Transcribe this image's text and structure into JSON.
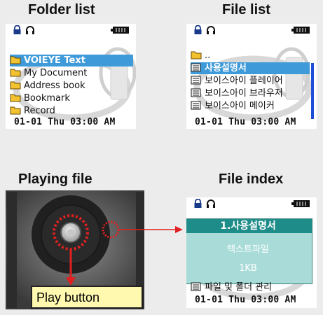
{
  "titles": {
    "folder_list": "Folder list",
    "file_list": "File list",
    "playing_file": "Playing file",
    "file_index": "File index"
  },
  "folder_list": {
    "items": [
      "VOIEYE Text",
      "My Document",
      "Address book",
      "Bookmark",
      "Record"
    ],
    "selected": "VOIEYE Text"
  },
  "file_list": {
    "parent": "..",
    "items": [
      "사용설명서",
      "보이스아이 플레이어",
      "보이스아이 브라우저",
      "보이스아이 메이커"
    ],
    "selected": "사용설명서"
  },
  "file_index": {
    "popup_title": "1.사용설명서",
    "popup_type": "텍스트파일",
    "popup_size": "1KB",
    "below_item": "파일 및 폴더 관리"
  },
  "clock": "01-01 Thu  03:00 AM",
  "play_button_label": "Play button",
  "colors": {
    "selection": "#3e9ad8",
    "popup_bg": "#a9dcd8",
    "popup_title": "#1e8c88",
    "callout_red": "#e02020"
  },
  "icons": [
    "lock-icon",
    "headphones-icon",
    "battery-icon",
    "folder-icon",
    "document-icon"
  ]
}
